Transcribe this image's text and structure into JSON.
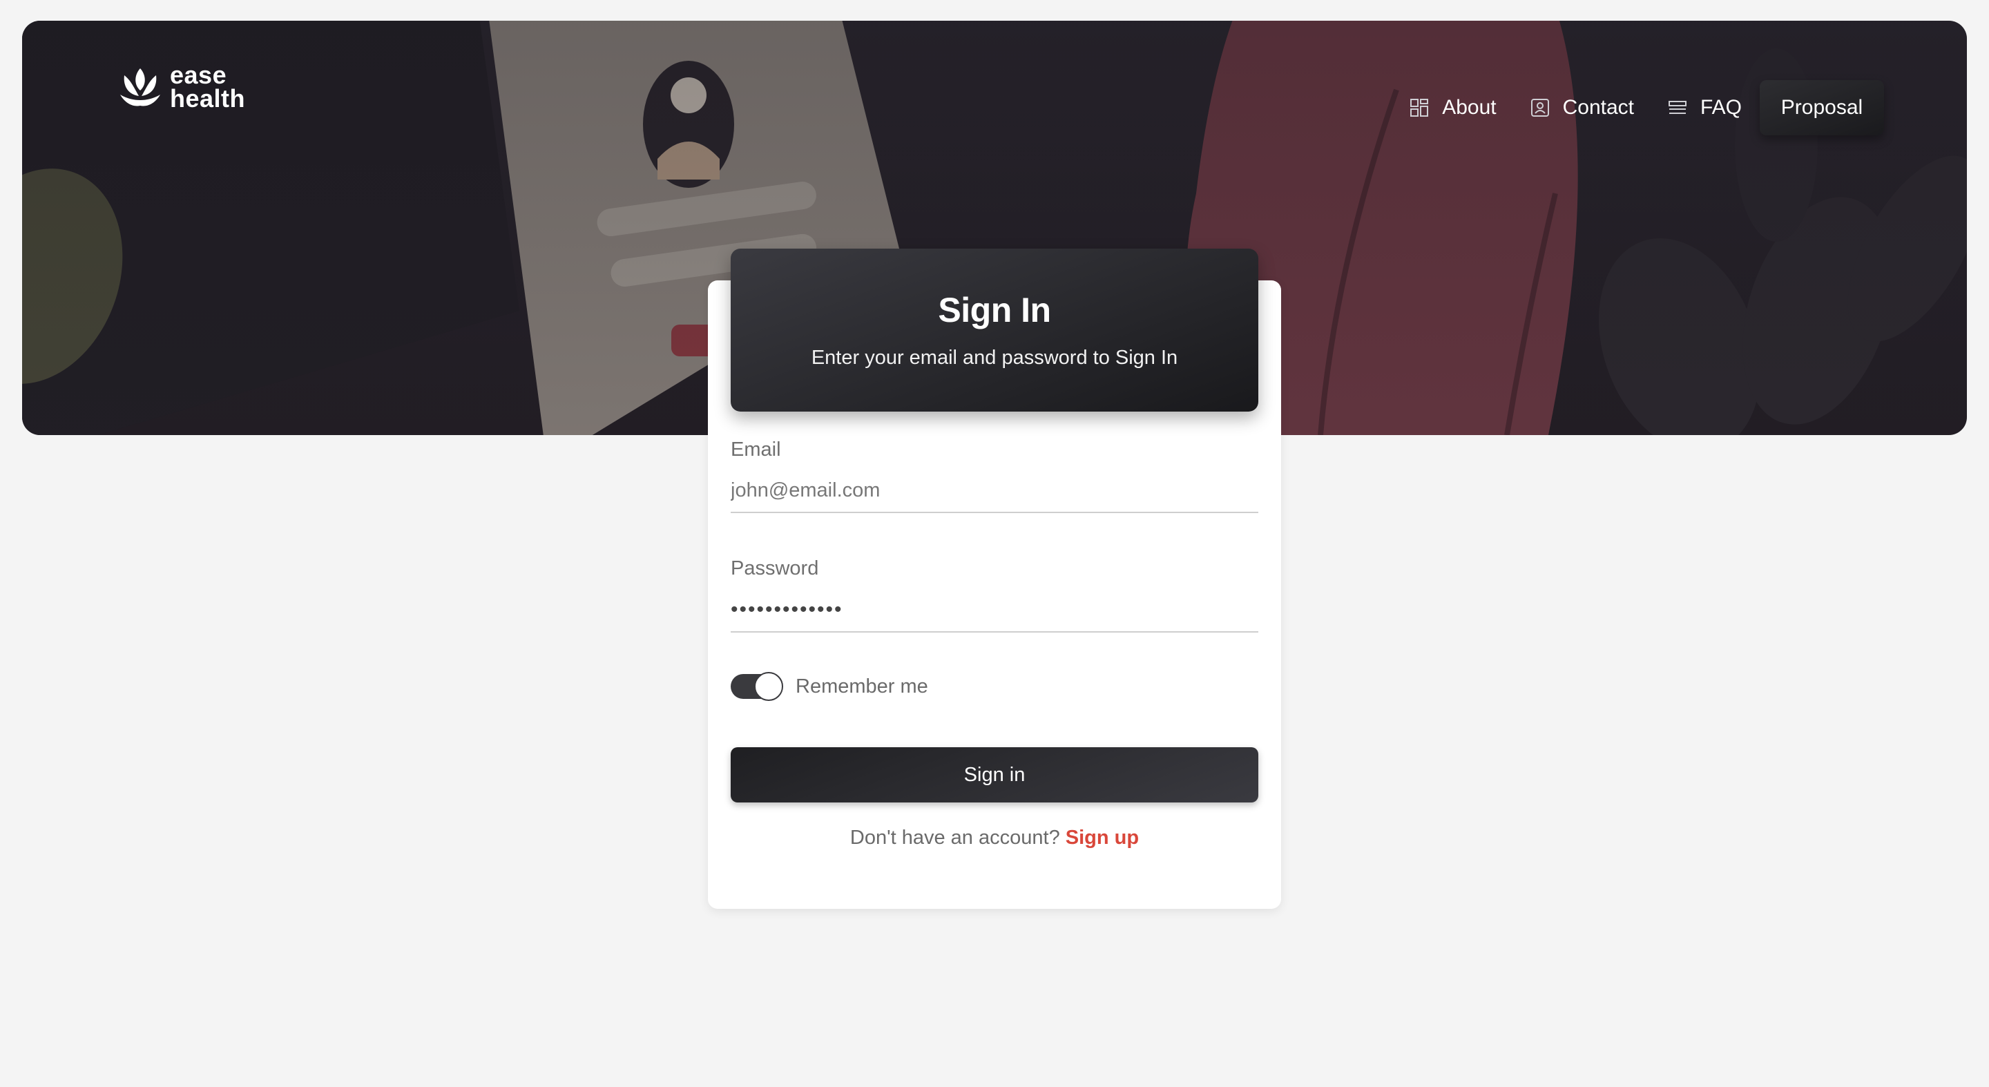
{
  "brand": {
    "line1": "ease",
    "line2": "health",
    "icon": "lotus-icon"
  },
  "nav": {
    "items": [
      {
        "label": "About",
        "icon": "grid-icon"
      },
      {
        "label": "Contact",
        "icon": "contact-card-icon"
      },
      {
        "label": "FAQ",
        "icon": "list-icon"
      }
    ],
    "cta_label": "Proposal"
  },
  "signin": {
    "title": "Sign In",
    "subtitle": "Enter your email and password to Sign In",
    "email_label": "Email",
    "email_placeholder": "john@email.com",
    "password_label": "Password",
    "password_value": "•••••••••••••",
    "remember_label": "Remember me",
    "remember_on": true,
    "submit_label": "Sign in",
    "no_account_text": "Don't have an account? ",
    "signup_label": "Sign up"
  },
  "colors": {
    "accent_link": "#d9473a",
    "hero_bg": "#2b2730",
    "button_dark": "#1f1f22"
  }
}
